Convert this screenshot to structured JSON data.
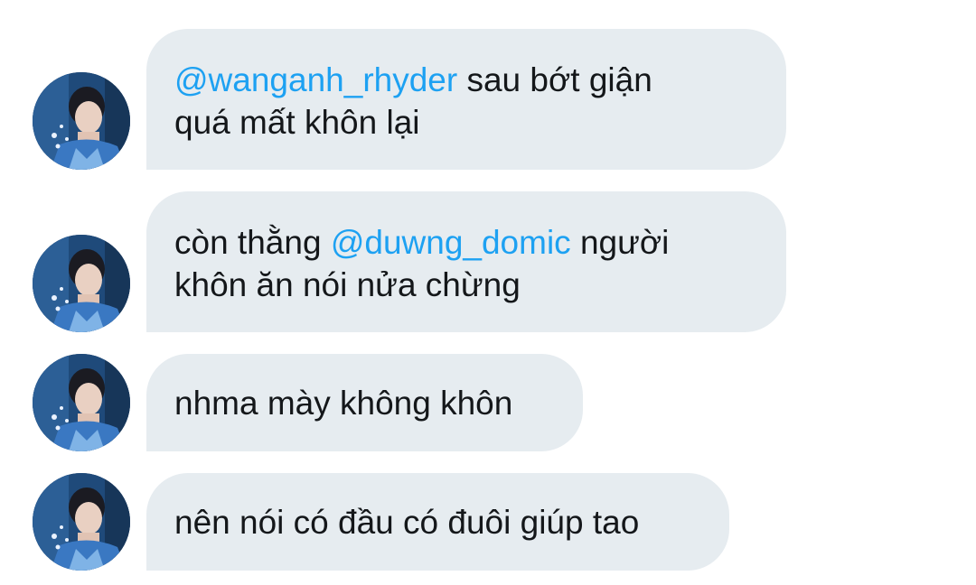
{
  "conversation": {
    "colors": {
      "bubble_background": "#e6ecf0",
      "text": "#14171a",
      "mention": "#1da1f2",
      "page_background": "#ffffff"
    },
    "messages": [
      {
        "lines": [
          {
            "mention": "@wanganh_rhyder",
            "text": " sau bớt giận"
          },
          {
            "text": "quá mất khôn lại"
          }
        ],
        "avatar_icon": "user-avatar-icon"
      },
      {
        "lines": [
          {
            "prefix": "còn thằng ",
            "mention": "@duwng_domic",
            "text": " người"
          },
          {
            "text": "khôn ăn nói nửa chừng"
          }
        ],
        "avatar_icon": "user-avatar-icon"
      },
      {
        "lines": [
          {
            "text": "nhma mày không khôn"
          }
        ],
        "avatar_icon": "user-avatar-icon"
      },
      {
        "lines": [
          {
            "text": "nên nói có đầu có đuôi giúp tao"
          }
        ],
        "avatar_icon": "user-avatar-icon"
      }
    ]
  }
}
